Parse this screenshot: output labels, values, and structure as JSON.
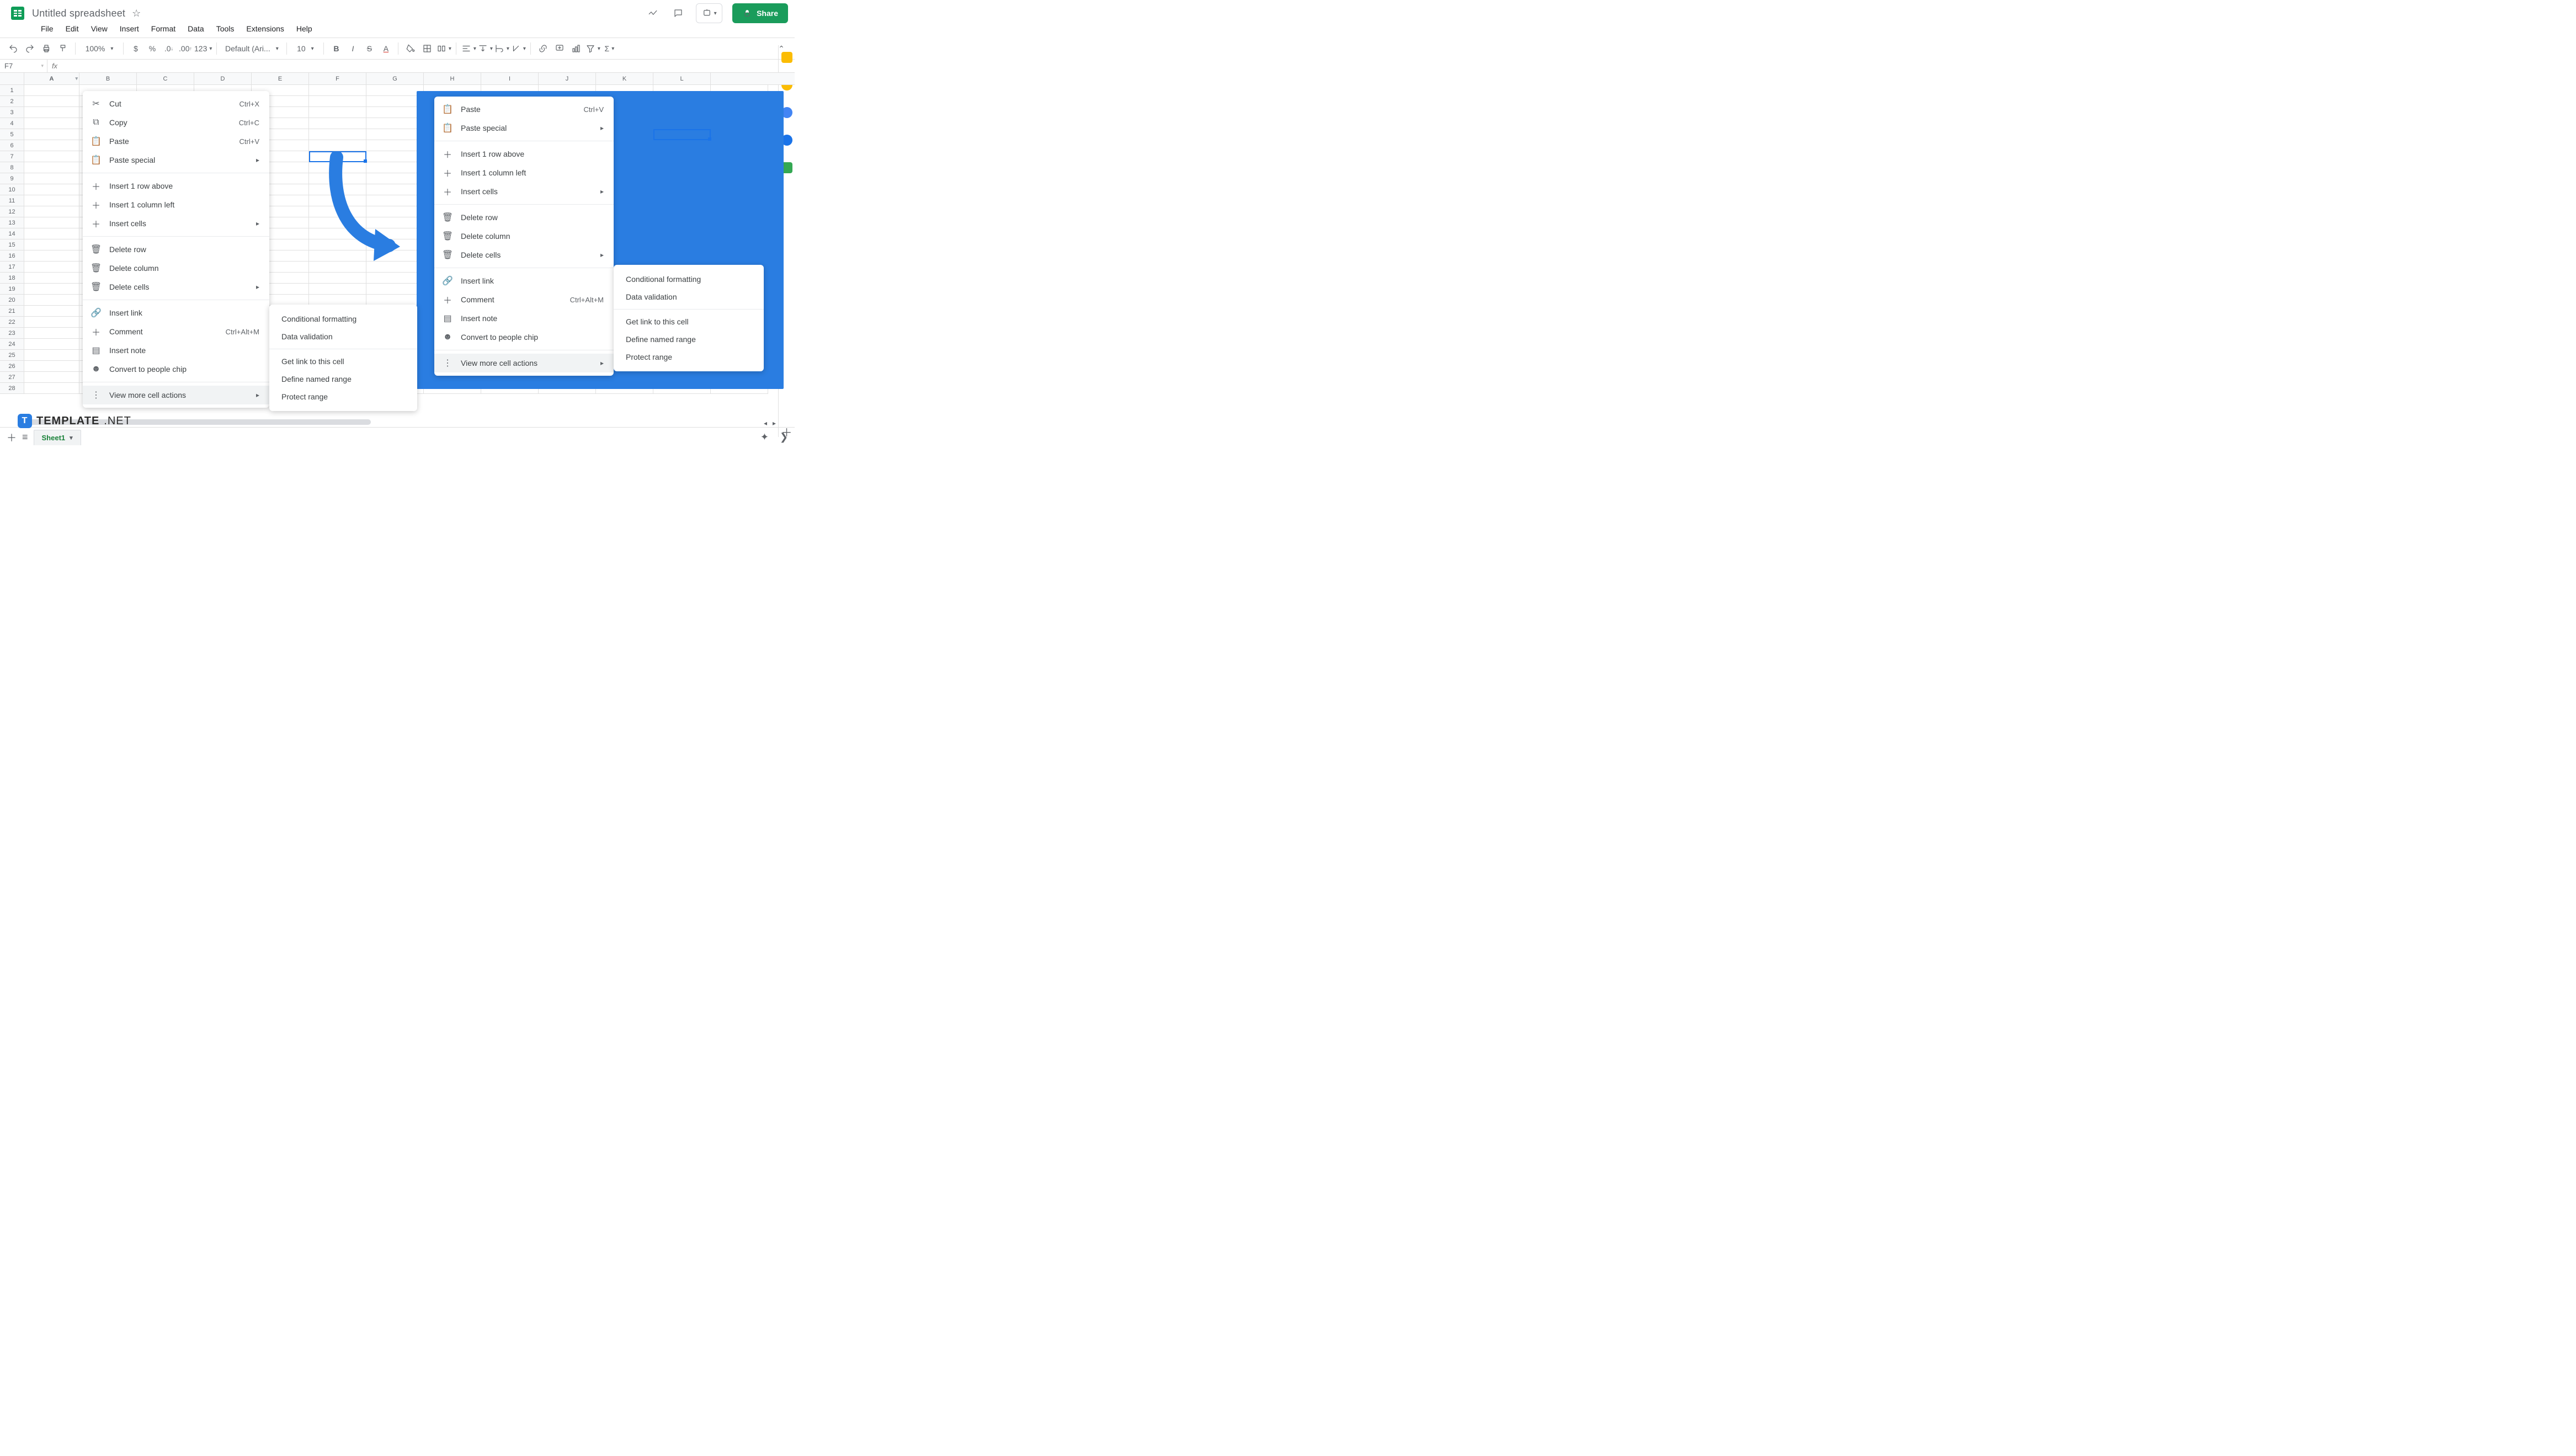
{
  "doc": {
    "title": "Untitled spreadsheet"
  },
  "menus": [
    "File",
    "Edit",
    "View",
    "Insert",
    "Format",
    "Data",
    "Tools",
    "Extensions",
    "Help"
  ],
  "share": {
    "label": "Share"
  },
  "toolbar": {
    "zoom": "100%",
    "currency": "$",
    "percent": "%",
    "dec_dec": ".0",
    "dec_inc": ".00",
    "num_fmt": "123",
    "font": "Default (Ari...",
    "size": "10"
  },
  "namebox": "F7",
  "columns": [
    "A",
    "B",
    "C",
    "D",
    "E",
    "F",
    "G",
    "H",
    "I",
    "J",
    "K",
    "L"
  ],
  "row_count": 28,
  "selected_column_index": 0,
  "ctx": {
    "cut": "Cut",
    "cut_sc": "Ctrl+X",
    "copy": "Copy",
    "copy_sc": "Ctrl+C",
    "paste": "Paste",
    "paste_sc": "Ctrl+V",
    "paste_special": "Paste special",
    "ins_row": "Insert 1 row above",
    "ins_col": "Insert 1 column left",
    "ins_cells": "Insert cells",
    "del_row": "Delete row",
    "del_col": "Delete column",
    "del_cells": "Delete cells",
    "link": "Insert link",
    "comment": "Comment",
    "comment_sc": "Ctrl+Alt+M",
    "note": "Insert note",
    "people": "Convert to people chip",
    "more": "View more cell actions"
  },
  "submenu": {
    "cond": "Conditional formatting",
    "dv": "Data validation",
    "getlink": "Get link to this cell",
    "named": "Define named range",
    "protect": "Protect range"
  },
  "sheet_tab": "Sheet1",
  "badge": {
    "t": "T",
    "a": "TEMPLATE",
    "b": ".NET"
  }
}
